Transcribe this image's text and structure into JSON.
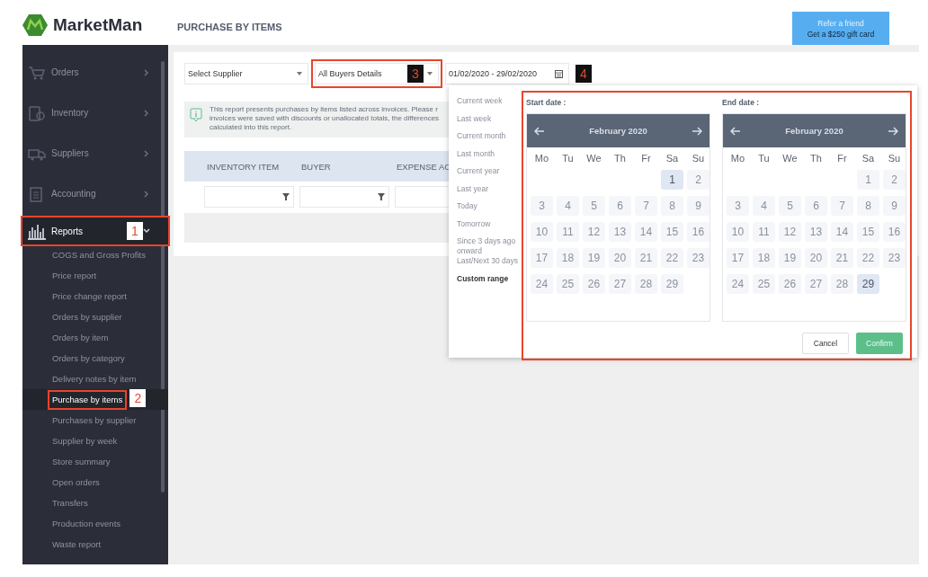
{
  "header": {
    "logo": "MarketMan",
    "title": "PURCHASE BY ITEMS",
    "promo": {
      "line1": "Refer a friend",
      "line2": "Get a $250 gift card"
    }
  },
  "sidebar": {
    "items": [
      {
        "label": "Orders",
        "expanded": false,
        "selected": false
      },
      {
        "label": "Inventory",
        "expanded": false,
        "selected": false
      },
      {
        "label": "Suppliers",
        "expanded": false,
        "selected": false
      },
      {
        "label": "Accounting",
        "expanded": false,
        "selected": false
      },
      {
        "label": "Reports",
        "expanded": true,
        "selected": true,
        "callout": "1",
        "children": [
          {
            "label": "COGS and Gross Profits",
            "selected": false
          },
          {
            "label": "Price report",
            "selected": false
          },
          {
            "label": "Price change report",
            "selected": false
          },
          {
            "label": "Orders by supplier",
            "selected": false
          },
          {
            "label": "Orders by item",
            "selected": false
          },
          {
            "label": "Orders by category",
            "selected": false
          },
          {
            "label": "Delivery notes by item",
            "selected": false
          },
          {
            "label": "Purchase by items",
            "selected": true,
            "callout": "2"
          },
          {
            "label": "Purchases by supplier",
            "selected": false
          },
          {
            "label": "Supplier by week",
            "selected": false
          },
          {
            "label": "Store summary",
            "selected": false
          },
          {
            "label": "Open orders",
            "selected": false
          },
          {
            "label": "Transfers",
            "selected": false
          },
          {
            "label": "Production events",
            "selected": false
          },
          {
            "label": "Waste report",
            "selected": false
          }
        ]
      }
    ]
  },
  "filters": [
    {
      "kind": "select",
      "value": "Select Supplier"
    },
    {
      "kind": "select",
      "value": "All Buyers Details",
      "callout": "3"
    },
    {
      "kind": "date",
      "value": "01/02/2020 - 29/02/2020",
      "callout": "4"
    }
  ],
  "info": "This report presents purchases by items listed across invoices. Please r\ninvoices were saved with discounts or unallocated totals, the differences\ncalculated into this report.",
  "table": {
    "columns": [
      "INVENTORY ITEM",
      "BUYER",
      "EXPENSE AC"
    ]
  },
  "date_picker": {
    "ranges": [
      {
        "label": "Current week",
        "selected": false
      },
      {
        "label": "Last week",
        "selected": false
      },
      {
        "label": "Current month",
        "selected": false
      },
      {
        "label": "Last month",
        "selected": false
      },
      {
        "label": "Current year",
        "selected": false
      },
      {
        "label": "Last year",
        "selected": false
      },
      {
        "label": "Today",
        "selected": false
      },
      {
        "label": "Tomorrow",
        "selected": false
      },
      {
        "label": "Since 3 days ago onward",
        "selected": false
      },
      {
        "label": "Last/Next 30 days",
        "selected": false
      },
      {
        "label": "Custom range",
        "selected": true
      }
    ],
    "calendars": [
      {
        "label": "Start date :",
        "month": "February 2020",
        "weekdays": [
          "Mo",
          "Tu",
          "We",
          "Th",
          "Fr",
          "Sa",
          "Su"
        ],
        "days": [
          {
            "day": "1",
            "selected": true
          },
          {
            "day": "2",
            "selected": false
          },
          {
            "day": "3",
            "selected": false
          },
          {
            "day": "4",
            "selected": false
          },
          {
            "day": "5",
            "selected": false
          },
          {
            "day": "6",
            "selected": false
          },
          {
            "day": "7",
            "selected": false
          },
          {
            "day": "8",
            "selected": false
          },
          {
            "day": "9",
            "selected": false
          },
          {
            "day": "10",
            "selected": false
          },
          {
            "day": "11",
            "selected": false
          },
          {
            "day": "12",
            "selected": false
          },
          {
            "day": "13",
            "selected": false
          },
          {
            "day": "14",
            "selected": false
          },
          {
            "day": "15",
            "selected": false
          },
          {
            "day": "16",
            "selected": false
          },
          {
            "day": "17",
            "selected": false
          },
          {
            "day": "18",
            "selected": false
          },
          {
            "day": "19",
            "selected": false
          },
          {
            "day": "20",
            "selected": false
          },
          {
            "day": "21",
            "selected": false
          },
          {
            "day": "22",
            "selected": false
          },
          {
            "day": "23",
            "selected": false
          },
          {
            "day": "24",
            "selected": false
          },
          {
            "day": "25",
            "selected": false
          },
          {
            "day": "26",
            "selected": false
          },
          {
            "day": "27",
            "selected": false
          },
          {
            "day": "28",
            "selected": false
          },
          {
            "day": "29",
            "selected": false
          }
        ]
      },
      {
        "label": "End date :",
        "month": "February 2020",
        "weekdays": [
          "Mo",
          "Tu",
          "We",
          "Th",
          "Fr",
          "Sa",
          "Su"
        ],
        "days": [
          {
            "day": "1",
            "selected": false
          },
          {
            "day": "2",
            "selected": false
          },
          {
            "day": "3",
            "selected": false
          },
          {
            "day": "4",
            "selected": false
          },
          {
            "day": "5",
            "selected": false
          },
          {
            "day": "6",
            "selected": false
          },
          {
            "day": "7",
            "selected": false
          },
          {
            "day": "8",
            "selected": false
          },
          {
            "day": "9",
            "selected": false
          },
          {
            "day": "10",
            "selected": false
          },
          {
            "day": "11",
            "selected": false
          },
          {
            "day": "12",
            "selected": false
          },
          {
            "day": "13",
            "selected": false
          },
          {
            "day": "14",
            "selected": false
          },
          {
            "day": "15",
            "selected": false
          },
          {
            "day": "16",
            "selected": false
          },
          {
            "day": "17",
            "selected": false
          },
          {
            "day": "18",
            "selected": false
          },
          {
            "day": "19",
            "selected": false
          },
          {
            "day": "20",
            "selected": false
          },
          {
            "day": "21",
            "selected": false
          },
          {
            "day": "22",
            "selected": false
          },
          {
            "day": "23",
            "selected": false
          },
          {
            "day": "24",
            "selected": false
          },
          {
            "day": "25",
            "selected": false
          },
          {
            "day": "26",
            "selected": false
          },
          {
            "day": "27",
            "selected": false
          },
          {
            "day": "28",
            "selected": false
          },
          {
            "day": "29",
            "selected": true
          }
        ]
      }
    ],
    "buttons": [
      {
        "label": "Cancel",
        "kind": "secondary"
      },
      {
        "label": "Confirm",
        "kind": "primary"
      }
    ]
  }
}
